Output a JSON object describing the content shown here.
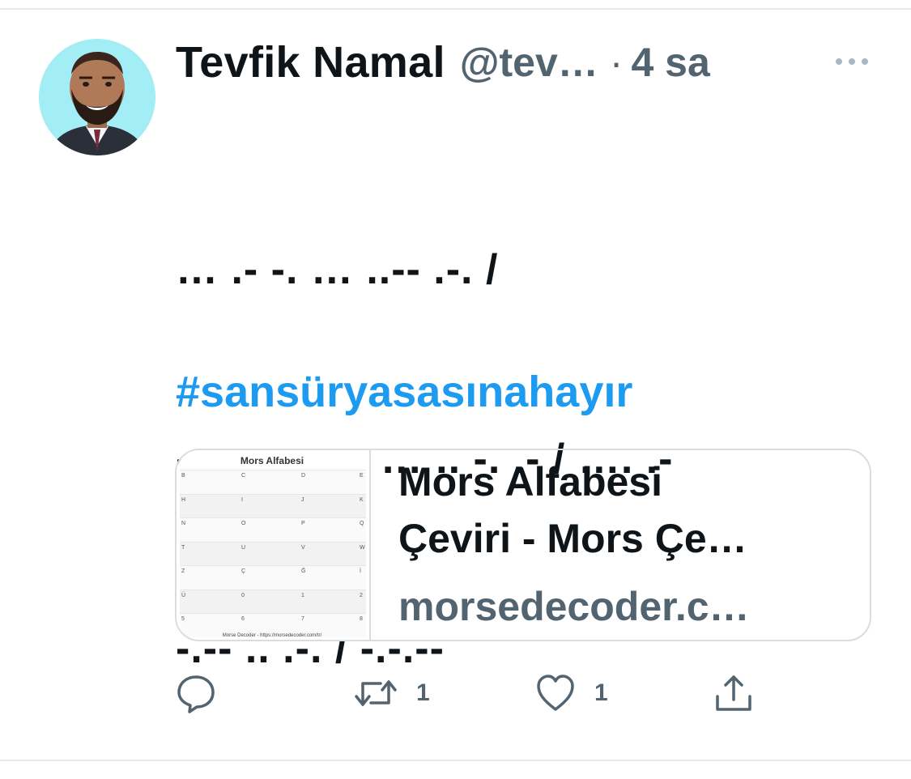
{
  "tweet": {
    "author_name": "Tevfik Namal",
    "handle": "@tev…",
    "separator": "·",
    "time": "4 sa",
    "body_lines": [
      "… .- -. … ..-- .-. /",
      "-.-- .- … .- … .. -. .- / …. .-",
      "-.-- .. .-. / -.-.--"
    ],
    "hashtag": "#sansüryasasınahayır"
  },
  "card": {
    "title_line1": "Mors Alfabesi",
    "title_line2": "Çeviri - Mors Çe…",
    "domain": "morsedecoder.c…",
    "thumbnail": {
      "title": "Mors Alfabesi",
      "footer": "Morse Decoder - https://morsedecoder.com/tr/",
      "rows": [
        [
          "B",
          "C",
          "D",
          "E"
        ],
        [
          "H",
          "I",
          "J",
          "K"
        ],
        [
          "N",
          "O",
          "P",
          "Q"
        ],
        [
          "T",
          "U",
          "V",
          "W"
        ],
        [
          "Z",
          "Ç",
          "Ğ",
          "İ"
        ],
        [
          "Ü",
          "0",
          "1",
          "2"
        ],
        [
          "5",
          "6",
          "7",
          "8"
        ]
      ]
    }
  },
  "actions": {
    "reply_icon": "reply-icon",
    "retweet_icon": "retweet-icon",
    "retweet_count": "1",
    "like_icon": "heart-icon",
    "like_count": "1",
    "share_icon": "share-icon"
  },
  "colors": {
    "text": "#0f1419",
    "muted": "#536471",
    "link": "#1d9bf0",
    "border": "#d7dde2",
    "avatar_bg": "#a3eef6"
  }
}
